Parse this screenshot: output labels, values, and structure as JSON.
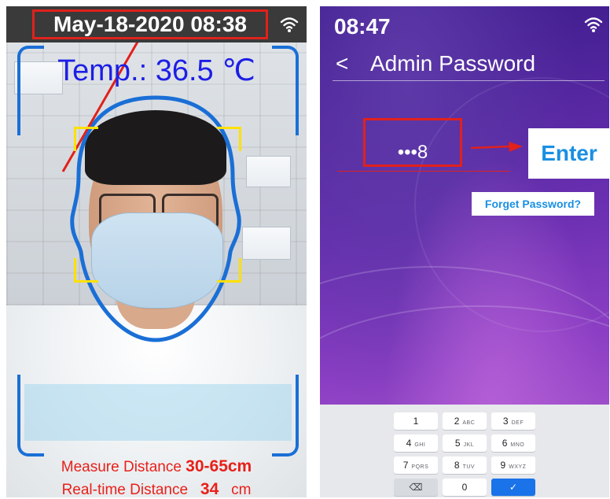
{
  "left_panel": {
    "datetime": "May-18-2020 08:38",
    "temperature": "Temp.: 36.5 ℃",
    "measure_distance_label": "Measure Distance",
    "measure_distance_value": "30-65cm",
    "realtime_distance_label": "Real-time Distance",
    "realtime_distance_value": "34",
    "realtime_distance_unit": "cm",
    "icons": {
      "wifi": "wifi-icon"
    },
    "colors": {
      "temp_text": "#1d1ee6",
      "face_outline": "#1a6fd6",
      "face_frame": "#ffe000",
      "distance_text": "#e8201a",
      "highlight": "#e0211c"
    }
  },
  "right_panel": {
    "time": "08:47",
    "back_glyph": "<",
    "title": "Admin Password",
    "password_value": "•••8",
    "enter_label": "Enter",
    "forget_label": "Forget Password?",
    "icons": {
      "wifi": "wifi-icon",
      "back": "chevron-left-icon",
      "backspace": "backspace-icon",
      "confirm": "check-icon"
    },
    "keypad": {
      "rows": [
        [
          {
            "main": "1",
            "sub": ""
          },
          {
            "main": "2",
            "sub": "ABC"
          },
          {
            "main": "3",
            "sub": "DEF"
          }
        ],
        [
          {
            "main": "4",
            "sub": "GHI"
          },
          {
            "main": "5",
            "sub": "JKL"
          },
          {
            "main": "6",
            "sub": "MNO"
          }
        ],
        [
          {
            "main": "7",
            "sub": "PQRS"
          },
          {
            "main": "8",
            "sub": "TUV"
          },
          {
            "main": "9",
            "sub": "WXYZ"
          }
        ],
        [
          {
            "main": "⌫",
            "sub": ""
          },
          {
            "main": "0",
            "sub": ""
          },
          {
            "main": "✓",
            "sub": ""
          }
        ]
      ]
    },
    "colors": {
      "accent": "#1a8fe3",
      "highlight": "#e0211c",
      "go_key": "#1a73e8"
    }
  }
}
